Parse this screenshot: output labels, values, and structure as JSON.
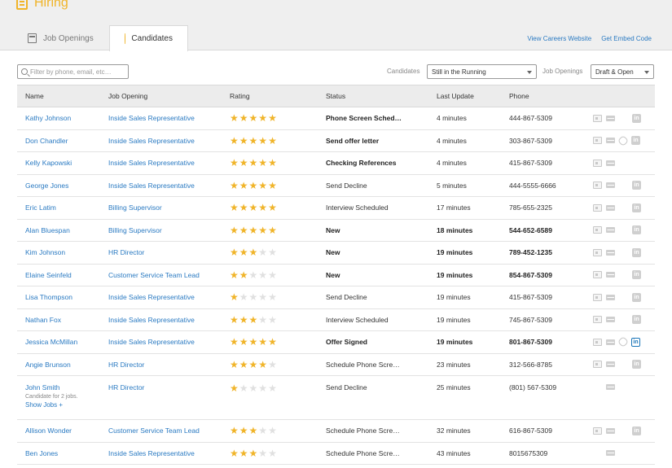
{
  "app": {
    "title": "Hiring"
  },
  "tabs": [
    {
      "label": "Job Openings",
      "icon": "calendar-icon",
      "active": false
    },
    {
      "label": "Candidates",
      "icon": "user-icon",
      "active": true
    }
  ],
  "top_links": {
    "view_careers": "View Careers Website",
    "embed_code": "Get Embed Code"
  },
  "filters": {
    "search_placeholder": "Filter by phone, email, etc…",
    "candidates_label": "Candidates",
    "candidates_value": "Still in the Running",
    "job_openings_label": "Job Openings",
    "job_openings_value": "Draft & Open"
  },
  "columns": [
    "Name",
    "Job Opening",
    "Rating",
    "Status",
    "Last Update",
    "Phone"
  ],
  "rows": [
    {
      "name": "Kathy Johnson",
      "job": "Inside Sales Representative",
      "rating": 5,
      "status": "Phone Screen Sched…",
      "update": "4 minutes",
      "phone": "444-867-5309",
      "bold_status": true,
      "bold_meta": false,
      "actions": [
        "resume",
        "mail",
        "none",
        "linkedin"
      ]
    },
    {
      "name": "Don Chandler",
      "job": "Inside Sales Representative",
      "rating": 5,
      "status": "Send offer letter",
      "update": "4 minutes",
      "phone": "303-867-5309",
      "bold_status": true,
      "bold_meta": false,
      "actions": [
        "resume",
        "mail",
        "link",
        "linkedin"
      ]
    },
    {
      "name": "Kelly Kapowski",
      "job": "Inside Sales Representative",
      "rating": 5,
      "status": "Checking References",
      "update": "4 minutes",
      "phone": "415-867-5309",
      "bold_status": true,
      "bold_meta": false,
      "actions": [
        "resume",
        "mail",
        "none",
        "none"
      ]
    },
    {
      "name": "George Jones",
      "job": "Inside Sales Representative",
      "rating": 5,
      "status": "Send Decline",
      "update": "5 minutes",
      "phone": "444-5555-6666",
      "bold_status": false,
      "bold_meta": false,
      "actions": [
        "resume",
        "mail",
        "none",
        "linkedin"
      ]
    },
    {
      "name": "Eric Latim",
      "job": "Billing Supervisor",
      "rating": 5,
      "status": "Interview Scheduled",
      "update": "17 minutes",
      "phone": "785-655-2325",
      "bold_status": false,
      "bold_meta": false,
      "actions": [
        "resume",
        "mail",
        "none",
        "linkedin"
      ]
    },
    {
      "name": "Alan Bluespan",
      "job": "Billing Supervisor",
      "rating": 5,
      "status": "New",
      "update": "18 minutes",
      "phone": "544-652-6589",
      "bold_status": true,
      "bold_meta": true,
      "actions": [
        "resume",
        "mail",
        "none",
        "linkedin"
      ]
    },
    {
      "name": "Kim Johnson",
      "job": "HR Director",
      "rating": 3,
      "status": "New",
      "update": "19 minutes",
      "phone": "789-452-1235",
      "bold_status": true,
      "bold_meta": true,
      "actions": [
        "resume",
        "mail",
        "none",
        "linkedin"
      ]
    },
    {
      "name": "Elaine Seinfeld",
      "job": "Customer Service Team Lead",
      "rating": 2,
      "status": "New",
      "update": "19 minutes",
      "phone": "854-867-5309",
      "bold_status": true,
      "bold_meta": true,
      "actions": [
        "resume",
        "mail",
        "none",
        "linkedin"
      ]
    },
    {
      "name": "Lisa Thompson",
      "job": "Inside Sales Representative",
      "rating": 1,
      "status": "Send Decline",
      "update": "19 minutes",
      "phone": "415-867-5309",
      "bold_status": false,
      "bold_meta": false,
      "actions": [
        "resume",
        "mail",
        "none",
        "linkedin"
      ]
    },
    {
      "name": "Nathan Fox",
      "job": "Inside Sales Representative",
      "rating": 3,
      "status": "Interview Scheduled",
      "update": "19 minutes",
      "phone": "745-867-5309",
      "bold_status": false,
      "bold_meta": false,
      "actions": [
        "resume",
        "mail",
        "none",
        "linkedin"
      ]
    },
    {
      "name": "Jessica McMillan",
      "job": "Inside Sales Representative",
      "rating": 5,
      "status": "Offer Signed",
      "update": "19 minutes",
      "phone": "801-867-5309",
      "bold_status": true,
      "bold_meta": true,
      "actions": [
        "resume",
        "mail",
        "link",
        "linkedin-on"
      ]
    },
    {
      "name": "Angie Brunson",
      "job": "HR Director",
      "rating": 4,
      "status": "Schedule Phone Scre…",
      "update": "23 minutes",
      "phone": "312-566-8785",
      "bold_status": false,
      "bold_meta": false,
      "actions": [
        "resume",
        "mail",
        "none",
        "linkedin"
      ]
    },
    {
      "name": "John Smith",
      "job": "HR Director",
      "rating": 1,
      "status": "Send Decline",
      "update": "25 minutes",
      "phone": "(801) 567-5309",
      "bold_status": false,
      "bold_meta": false,
      "sub": "Candidate for 2 jobs.",
      "show_jobs": "Show Jobs +",
      "actions": [
        "none",
        "mail",
        "none",
        "none"
      ]
    },
    {
      "name": "Allison Wonder",
      "job": "Customer Service Team Lead",
      "rating": 3,
      "status": "Schedule Phone Scre…",
      "update": "32 minutes",
      "phone": "616-867-5309",
      "bold_status": false,
      "bold_meta": false,
      "actions": [
        "resume",
        "mail",
        "none",
        "linkedin"
      ]
    },
    {
      "name": "Ben Jones",
      "job": "Inside Sales Representative",
      "rating": 3,
      "status": "Schedule Phone Scre…",
      "update": "43 minutes",
      "phone": "8015675309",
      "bold_status": false,
      "bold_meta": false,
      "actions": [
        "none",
        "mail",
        "none",
        "none"
      ]
    }
  ],
  "colors": {
    "accent": "#f0b429",
    "link": "#2a7ac2",
    "linkedin": "#1a75b8"
  }
}
